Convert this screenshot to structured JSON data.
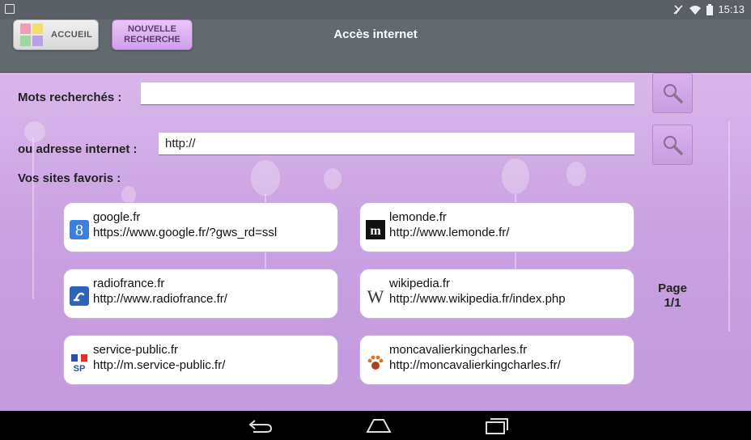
{
  "status_bar": {
    "time": "15:13"
  },
  "header": {
    "home_label": "ACCUEIL",
    "new_search_line1": "NOUVELLE",
    "new_search_line2": "RECHERCHE",
    "title": "Accès internet"
  },
  "search": {
    "keywords_label": "Mots recherchés :",
    "keywords_value": "",
    "address_label": "ou adresse internet :",
    "address_value": "http://"
  },
  "favorites_label": "Vos sites favoris :",
  "favorites": [
    {
      "name": "google.fr",
      "url": "https://www.google.fr/?gws_rd=ssl",
      "icon": "google-icon"
    },
    {
      "name": "lemonde.fr",
      "url": "http://www.lemonde.fr/",
      "icon": "lemonde-icon"
    },
    {
      "name": "radiofrance.fr",
      "url": "http://www.radiofrance.fr/",
      "icon": "radiofrance-icon"
    },
    {
      "name": "wikipedia.fr",
      "url": "http://www.wikipedia.fr/index.php",
      "icon": "wikipedia-icon"
    },
    {
      "name": "service-public.fr",
      "url": "http://m.service-public.fr/",
      "icon": "service-public-icon"
    },
    {
      "name": "moncavalierkingcharles.fr",
      "url": "http://moncavalierkingcharles.fr/",
      "icon": "paw-icon"
    }
  ],
  "pager": {
    "line1": "Page",
    "line2": "1/1"
  },
  "colors": {
    "background": "#caa2e2",
    "appbar": "#626a70",
    "new_search_button": "#d9b2ec"
  }
}
